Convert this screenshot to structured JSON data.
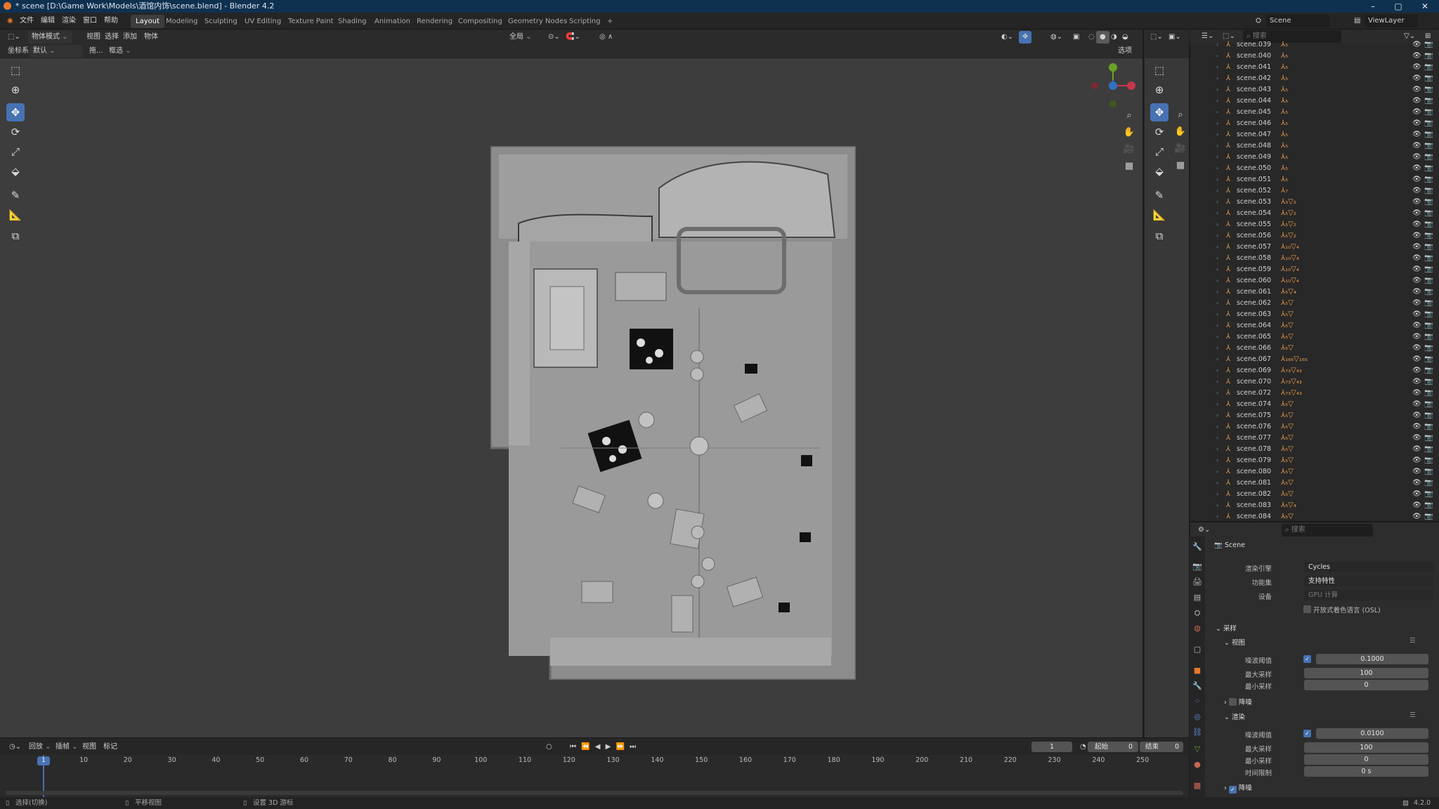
{
  "title": "* scene [D:\\Game Work\\Models\\酒馆内饰\\scene.blend] - Blender 4.2",
  "menu": [
    "文件",
    "编辑",
    "渲染",
    "窗口",
    "帮助"
  ],
  "workspaces": [
    "Layout",
    "Modeling",
    "Sculpting",
    "UV Editing",
    "Texture Paint",
    "Shading",
    "Animation",
    "Rendering",
    "Compositing",
    "Geometry Nodes",
    "Scripting"
  ],
  "scene_name": "Scene",
  "view_layer": "ViewLayer",
  "viewport_header": {
    "mode": "物体模式",
    "menus": [
      "视图",
      "选择",
      "添加",
      "物体"
    ],
    "transform_global": "全局",
    "coord_label": "坐标系:",
    "coord_value": "默认",
    "drag_label": "拖...",
    "select_box": "框选",
    "options": "选项"
  },
  "outliner": {
    "search_placeholder": "搜索",
    "rows": [
      {
        "name": "scene.039",
        "mod": "⅄₅"
      },
      {
        "name": "scene.040",
        "mod": "⅄₅"
      },
      {
        "name": "scene.041",
        "mod": "⅄₅"
      },
      {
        "name": "scene.042",
        "mod": "⅄₅"
      },
      {
        "name": "scene.043",
        "mod": "⅄₅"
      },
      {
        "name": "scene.044",
        "mod": "⅄₅"
      },
      {
        "name": "scene.045",
        "mod": "⅄₅"
      },
      {
        "name": "scene.046",
        "mod": "⅄₅"
      },
      {
        "name": "scene.047",
        "mod": "⅄₅"
      },
      {
        "name": "scene.048",
        "mod": "⅄₅"
      },
      {
        "name": "scene.049",
        "mod": "⅄₅"
      },
      {
        "name": "scene.050",
        "mod": "⅄₅"
      },
      {
        "name": "scene.051",
        "mod": "⅄₅"
      },
      {
        "name": "scene.052",
        "mod": "⅄₇"
      },
      {
        "name": "scene.053",
        "mod": "⅄₃▽₂"
      },
      {
        "name": "scene.054",
        "mod": "⅄₅▽₂"
      },
      {
        "name": "scene.055",
        "mod": "⅄₅▽₂"
      },
      {
        "name": "scene.056",
        "mod": "⅄₅▽₂"
      },
      {
        "name": "scene.057",
        "mod": "⅄₁₀▽₄"
      },
      {
        "name": "scene.058",
        "mod": "⅄₁₀▽₄"
      },
      {
        "name": "scene.059",
        "mod": "⅄₁₀▽₄"
      },
      {
        "name": "scene.060",
        "mod": "⅄₁₀▽₄"
      },
      {
        "name": "scene.061",
        "mod": "⅄₅▽₄"
      },
      {
        "name": "scene.062",
        "mod": "⅄₅▽"
      },
      {
        "name": "scene.063",
        "mod": "⅄₅▽"
      },
      {
        "name": "scene.064",
        "mod": "⅄₅▽"
      },
      {
        "name": "scene.065",
        "mod": "⅄₅▽"
      },
      {
        "name": "scene.066",
        "mod": "⅄₅▽"
      },
      {
        "name": "scene.067",
        "mod": "⅄₁₆₆▽₁₆₅"
      },
      {
        "name": "scene.069",
        "mod": "⅄₇₃▽₄₃"
      },
      {
        "name": "scene.070",
        "mod": "⅄₇₃▽₄₃"
      },
      {
        "name": "scene.072",
        "mod": "⅄₇₃▽₄₃"
      },
      {
        "name": "scene.074",
        "mod": "⅄₅▽"
      },
      {
        "name": "scene.075",
        "mod": "⅄₅▽"
      },
      {
        "name": "scene.076",
        "mod": "⅄₅▽"
      },
      {
        "name": "scene.077",
        "mod": "⅄₅▽"
      },
      {
        "name": "scene.078",
        "mod": "⅄₅▽"
      },
      {
        "name": "scene.079",
        "mod": "⅄₅▽"
      },
      {
        "name": "scene.080",
        "mod": "⅄₅▽"
      },
      {
        "name": "scene.081",
        "mod": "⅄₅▽"
      },
      {
        "name": "scene.082",
        "mod": "⅄₅▽"
      },
      {
        "name": "scene.083",
        "mod": "⅄₅▽₄"
      },
      {
        "name": "scene.084",
        "mod": "⅄₅▽"
      }
    ]
  },
  "properties": {
    "search_placeholder": "搜索",
    "header": "Scene",
    "render_engine_label": "渲染引擎",
    "render_engine": "Cycles",
    "feature_set_label": "功能集",
    "feature_set": "支持特性",
    "device_label": "设备",
    "device": "GPU 计算",
    "osl": "开放式着色语言 (OSL)",
    "sampling": "采样",
    "viewport": "视图",
    "noise_threshold_label": "噪波阈值",
    "vp_noise": "0.1000",
    "max_samples_label": "最大采样",
    "vp_max": "100",
    "min_samples_label": "最小采样",
    "vp_min": "0",
    "denoise": "降噪",
    "render": "渲染",
    "r_noise": "0.0100",
    "r_max": "100",
    "r_min": "0",
    "time_limit_label": "时间限制",
    "r_time": "0 s",
    "denoise2": "降噪"
  },
  "timeline": {
    "menus": [
      "回放",
      "插帧",
      "视图",
      "标记"
    ],
    "current_frame": "1",
    "start_label": "起始",
    "start": "0",
    "end_label": "结束",
    "end": "0",
    "frame_marker": "1",
    "ticks": [
      "10",
      "20",
      "30",
      "40",
      "50",
      "60",
      "70",
      "80",
      "90",
      "100",
      "110",
      "120",
      "130",
      "140",
      "150",
      "160",
      "170",
      "180",
      "190",
      "200",
      "210",
      "220",
      "230",
      "240",
      "250"
    ]
  },
  "status": {
    "select": "选择(切换)",
    "pan": "平移视图",
    "cursor": "设置 3D 游标",
    "version": "4.2.0"
  },
  "colors": {
    "accent": "#4772b3",
    "title_bar": "#0f3150",
    "orange": "#e89b4c"
  }
}
